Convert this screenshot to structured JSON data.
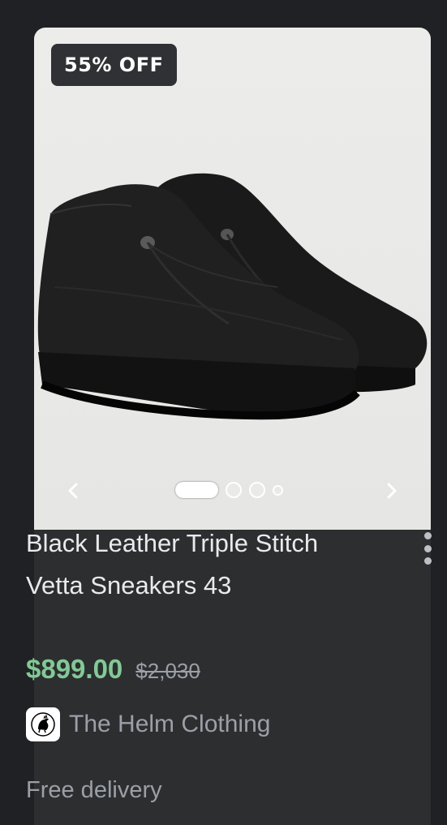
{
  "product": {
    "discount_badge": "55% OFF",
    "title": "Black Leather Triple Stitch Vetta Sneakers 43",
    "price": "$899.00",
    "original_price": "$2,030",
    "seller": "The Helm Clothing",
    "delivery": "Free delivery"
  },
  "carousel": {
    "total_images": 4,
    "active_index": 0,
    "prev_icon": "chevron-left-icon",
    "next_icon": "chevron-right-icon"
  },
  "colors": {
    "price": "#81c995",
    "background": "#202124",
    "card": "#2d2e30"
  }
}
